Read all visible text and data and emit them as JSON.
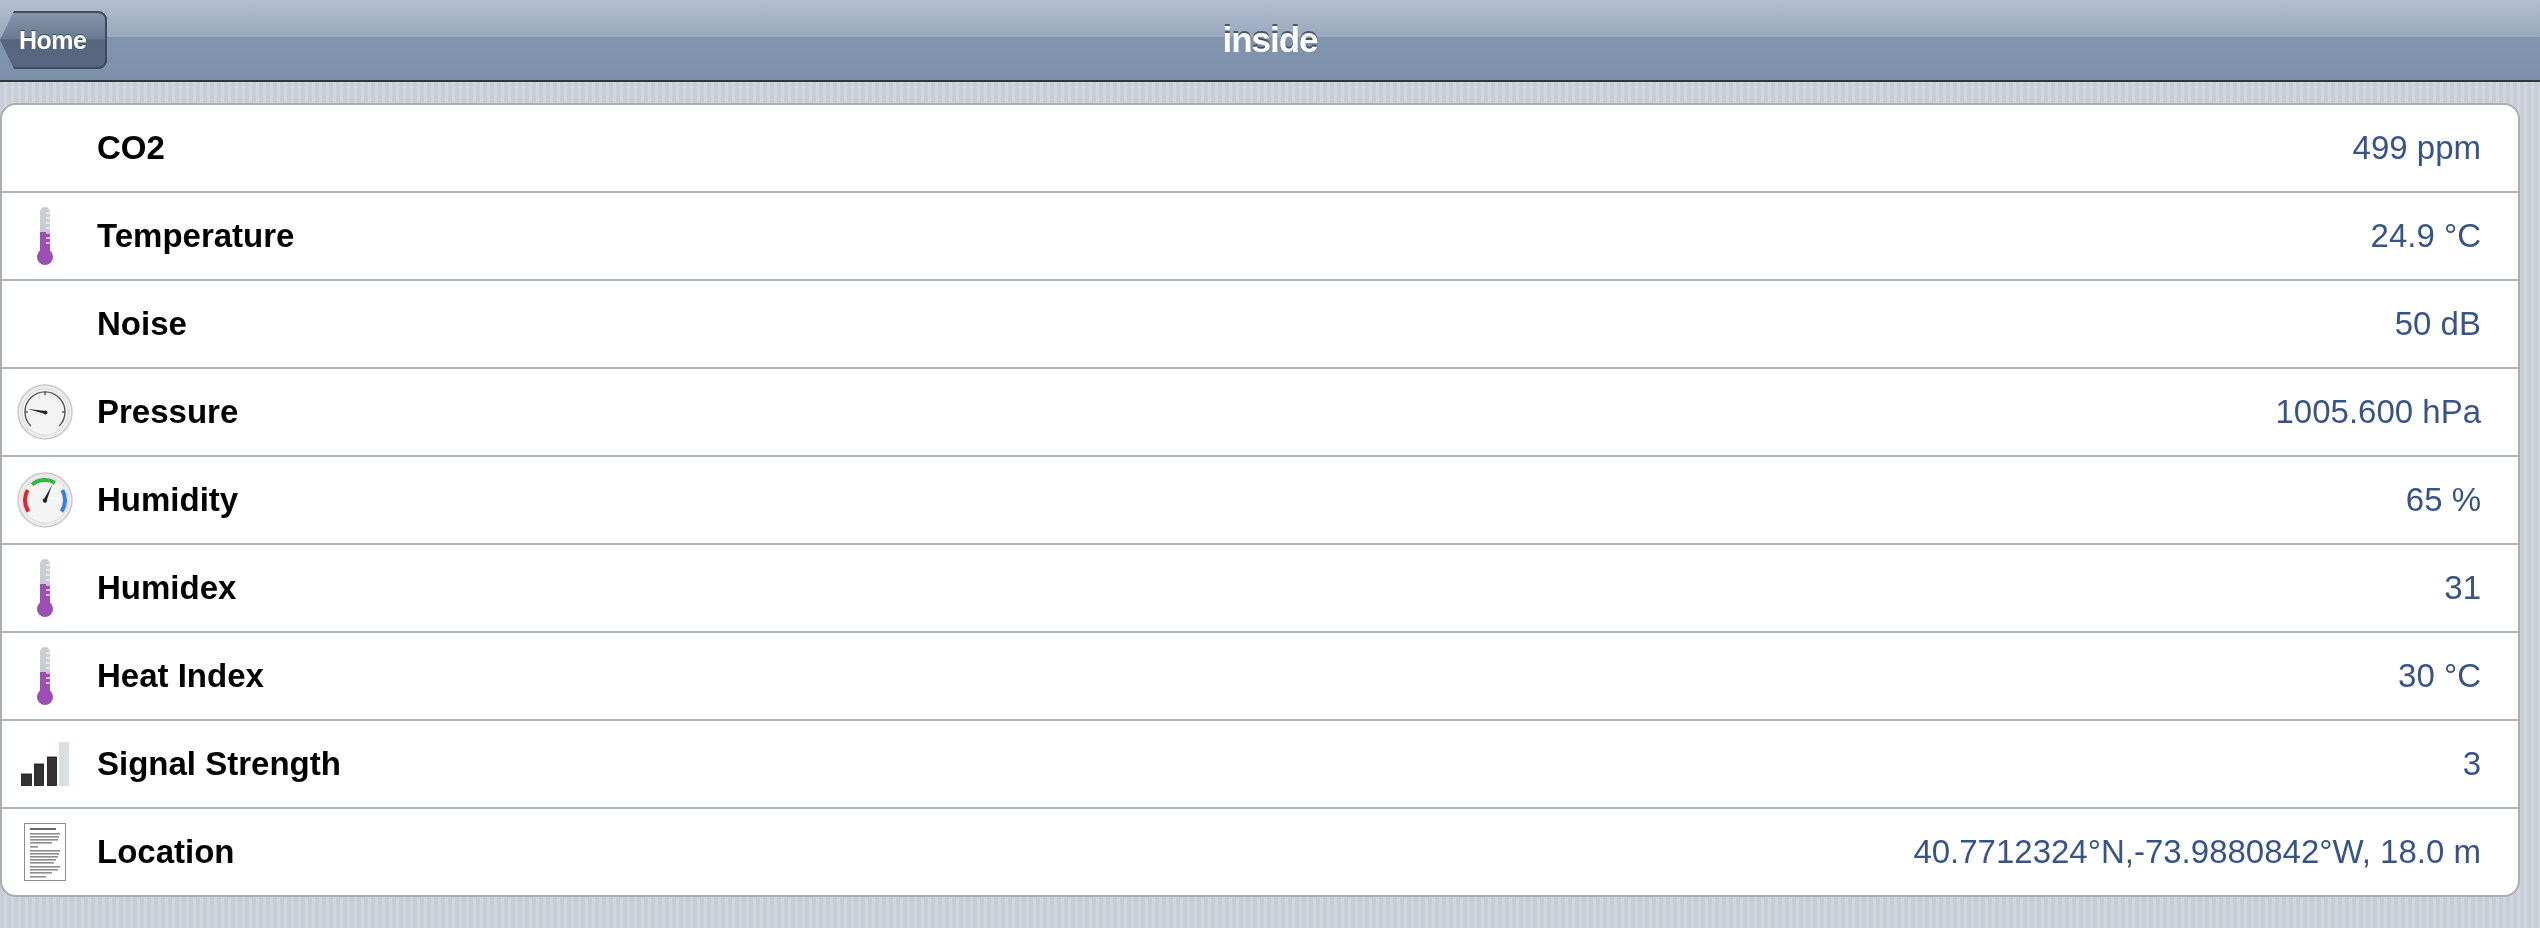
{
  "nav_bar": {
    "back_button": "Home",
    "title": "inside"
  },
  "readings": [
    {
      "kind": "plain",
      "label": "CO2",
      "value": "499 ppm"
    },
    {
      "kind": "temperature",
      "label": "Temperature",
      "value": "24.9 °C"
    },
    {
      "kind": "plain",
      "label": "Noise",
      "value": "50 dB"
    },
    {
      "kind": "pressure",
      "label": "Pressure",
      "value": "1005.600 hPa"
    },
    {
      "kind": "humidity",
      "label": "Humidity",
      "value": "65 %"
    },
    {
      "kind": "temperature",
      "label": "Humidex",
      "value": "31"
    },
    {
      "kind": "temperature",
      "label": "Heat Index",
      "value": "30 °C"
    },
    {
      "kind": "signal",
      "label": "Signal Strength",
      "value": "3"
    },
    {
      "kind": "location",
      "label": "Location",
      "value": "40.7712324°N,-73.9880842°W, 18.0 m"
    }
  ]
}
